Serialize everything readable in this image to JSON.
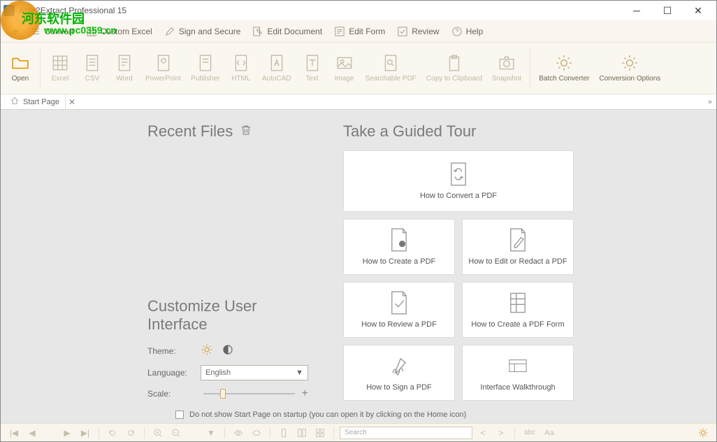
{
  "window": {
    "title": "Able2Extract Professional 15"
  },
  "watermark": {
    "text": "河东软件园",
    "url": "www.pc0359.cn"
  },
  "menu": [
    {
      "label": "...e"
    },
    {
      "label": "Convert"
    },
    {
      "label": "Custom Excel"
    },
    {
      "label": "Sign and Secure"
    },
    {
      "label": "Edit Document"
    },
    {
      "label": "Edit Form"
    },
    {
      "label": "Review"
    },
    {
      "label": "Help"
    }
  ],
  "toolbar": [
    {
      "label": "Open",
      "icon": "folder"
    },
    {
      "label": "Excel",
      "icon": "grid"
    },
    {
      "label": "CSV",
      "icon": "doc"
    },
    {
      "label": "Word",
      "icon": "doc"
    },
    {
      "label": "PowerPoint",
      "icon": "doc"
    },
    {
      "label": "Publisher",
      "icon": "doc"
    },
    {
      "label": "HTML",
      "icon": "code"
    },
    {
      "label": "AutoCAD",
      "icon": "doc"
    },
    {
      "label": "Text",
      "icon": "doc"
    },
    {
      "label": "Image",
      "icon": "image"
    },
    {
      "label": "Searchable PDF",
      "icon": "doc"
    },
    {
      "label": "Copy to Clipboard",
      "icon": "clipboard"
    },
    {
      "label": "Snapshot",
      "icon": "camera"
    },
    {
      "label": "Batch Converter",
      "icon": "gear"
    },
    {
      "label": "Conversion Options",
      "icon": "gear"
    }
  ],
  "tab": {
    "label": "Start Page"
  },
  "recent": {
    "title": "Recent Files"
  },
  "customize": {
    "title": "Customize User Interface",
    "theme_label": "Theme:",
    "language_label": "Language:",
    "language_value": "English",
    "scale_label": "Scale:"
  },
  "tour": {
    "title": "Take a Guided Tour",
    "cards": [
      "How to Convert a PDF",
      "How to Create a PDF",
      "How to Edit or Redact a PDF",
      "How to Review a PDF",
      "How to Create a PDF Form",
      "How to Sign a PDF",
      "Interface Walkthrough"
    ]
  },
  "startup_checkbox": "Do not show Start Page on startup (you can open it by clicking on the Home icon)",
  "footer": {
    "search_placeholder": "Search",
    "abc": "abc",
    "aa": "Aa"
  }
}
